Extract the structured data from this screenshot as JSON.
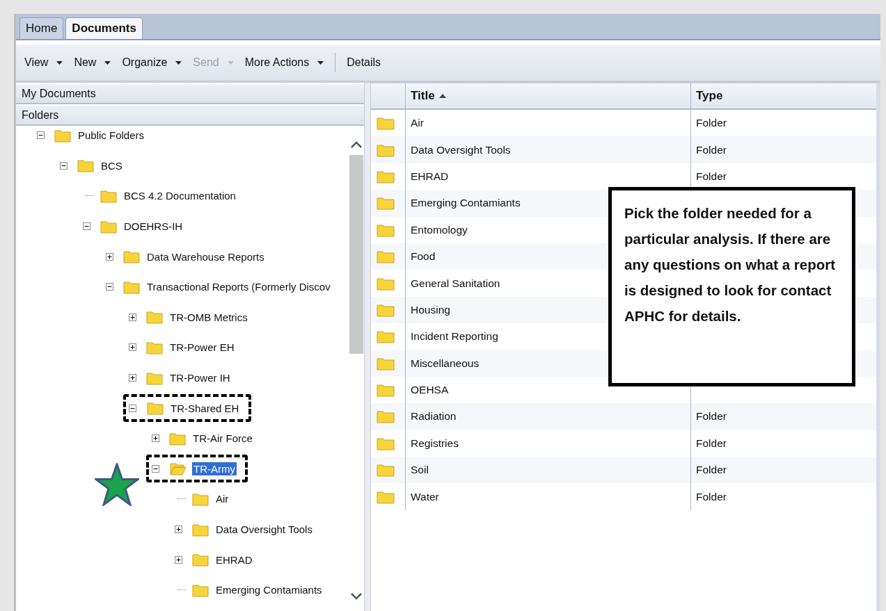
{
  "tabs": [
    {
      "label": "Home",
      "selected": false
    },
    {
      "label": "Documents",
      "selected": true
    }
  ],
  "toolbar": [
    {
      "label": "View",
      "dropdown": true,
      "disabled": false
    },
    {
      "label": "New",
      "dropdown": true,
      "disabled": false
    },
    {
      "label": "Organize",
      "dropdown": true,
      "disabled": false
    },
    {
      "label": "Send",
      "dropdown": true,
      "disabled": true
    },
    {
      "label": "More Actions",
      "dropdown": true,
      "disabled": false
    },
    {
      "label": "Details",
      "dropdown": false,
      "disabled": false
    }
  ],
  "sidebar": {
    "sections": [
      "My Documents",
      "Folders"
    ],
    "tree": [
      {
        "label": "Public Folders",
        "expanded": true,
        "selected": false,
        "children": [
          {
            "label": "BCS",
            "expanded": true,
            "selected": false,
            "children": [
              {
                "label": "BCS 4.2 Documentation",
                "selected": false
              },
              {
                "label": "DOEHRS-IH",
                "expanded": true,
                "selected": false,
                "children": [
                  {
                    "label": "Data Warehouse Reports",
                    "expanded": false,
                    "selected": false
                  },
                  {
                    "label": "Transactional Reports (Formerly Discov",
                    "expanded": true,
                    "selected": false,
                    "children": [
                      {
                        "label": "TR-OMB Metrics",
                        "expanded": false,
                        "selected": false
                      },
                      {
                        "label": "TR-Power EH",
                        "expanded": false,
                        "selected": false
                      },
                      {
                        "label": "TR-Power IH",
                        "expanded": false,
                        "selected": false
                      },
                      {
                        "label": "TR-Shared EH",
                        "expanded": true,
                        "selected": false,
                        "highlighted": true,
                        "children": [
                          {
                            "label": "TR-Air Force",
                            "expanded": false,
                            "selected": false
                          },
                          {
                            "label": "TR-Army",
                            "expanded": true,
                            "selected": true,
                            "highlighted": true,
                            "starred": true,
                            "children": [
                              {
                                "label": "Air",
                                "selected": false
                              },
                              {
                                "label": "Data Oversight Tools",
                                "expanded": false,
                                "selected": false
                              },
                              {
                                "label": "EHRAD",
                                "expanded": false,
                                "selected": false
                              },
                              {
                                "label": "Emerging Contamiants",
                                "selected": false
                              }
                            ]
                          }
                        ]
                      }
                    ]
                  }
                ]
              }
            ]
          }
        ]
      }
    ]
  },
  "table": {
    "columns": [
      {
        "label": "Title",
        "sorted_ascending": true
      },
      {
        "label": "Type"
      }
    ],
    "rows": [
      {
        "title": "Air",
        "type": "Folder"
      },
      {
        "title": "Data Oversight Tools",
        "type": "Folder"
      },
      {
        "title": "EHRAD",
        "type": "Folder"
      },
      {
        "title": "Emerging Contamiants"
      },
      {
        "title": "Entomology"
      },
      {
        "title": "Food"
      },
      {
        "title": "General Sanitation"
      },
      {
        "title": "Housing"
      },
      {
        "title": "Incident Reporting"
      },
      {
        "title": "Miscellaneous"
      },
      {
        "title": "OEHSA"
      },
      {
        "title": "Radiation",
        "type": "Folder"
      },
      {
        "title": "Registries",
        "type": "Folder"
      },
      {
        "title": "Soil",
        "type": "Folder"
      },
      {
        "title": "Water",
        "type": "Folder"
      }
    ]
  },
  "callout": {
    "text": "Pick the folder needed for a particular analysis. If there are any questions on what a report is designed to look for contact APHC for details."
  }
}
